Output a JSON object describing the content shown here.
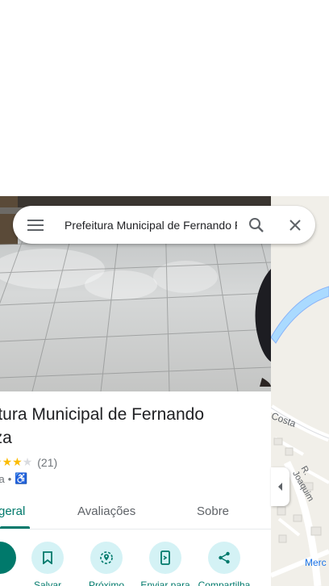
{
  "search": {
    "query": "Prefeitura Municipal de Fernando Prestes"
  },
  "place": {
    "title": "Prefeitura Municipal de Fernando Prestes",
    "title_visible": "eitura Municipal de Fernando\noza",
    "title_line1": "eitura Municipal de Fernando",
    "title_line2": "oza",
    "rating_stars": 3,
    "rating_count": "(21)",
    "category_fragment": "ura",
    "separator": "•",
    "accessibility_icon": "wheelchair-icon"
  },
  "tabs": [
    {
      "label": "geral",
      "active": true
    },
    {
      "label": "Avaliações",
      "active": false
    },
    {
      "label": "Sobre",
      "active": false
    }
  ],
  "actions": [
    {
      "label": "",
      "icon": "directions-icon"
    },
    {
      "label": "Salvar",
      "icon": "bookmark-icon"
    },
    {
      "label": "Próximo",
      "icon": "nearby-icon"
    },
    {
      "label": "Enviar para",
      "icon": "send-to-phone-icon"
    },
    {
      "label": "Compartilha",
      "icon": "share-icon"
    }
  ],
  "map": {
    "labels": [
      "Costa",
      "R. Joaquim",
      "Merc"
    ]
  },
  "colors": {
    "accent": "#00796b",
    "action_bg": "#d4f2f5",
    "star": "#fbbc04",
    "map_bg": "#f1efe9",
    "water": "#aadaff"
  }
}
